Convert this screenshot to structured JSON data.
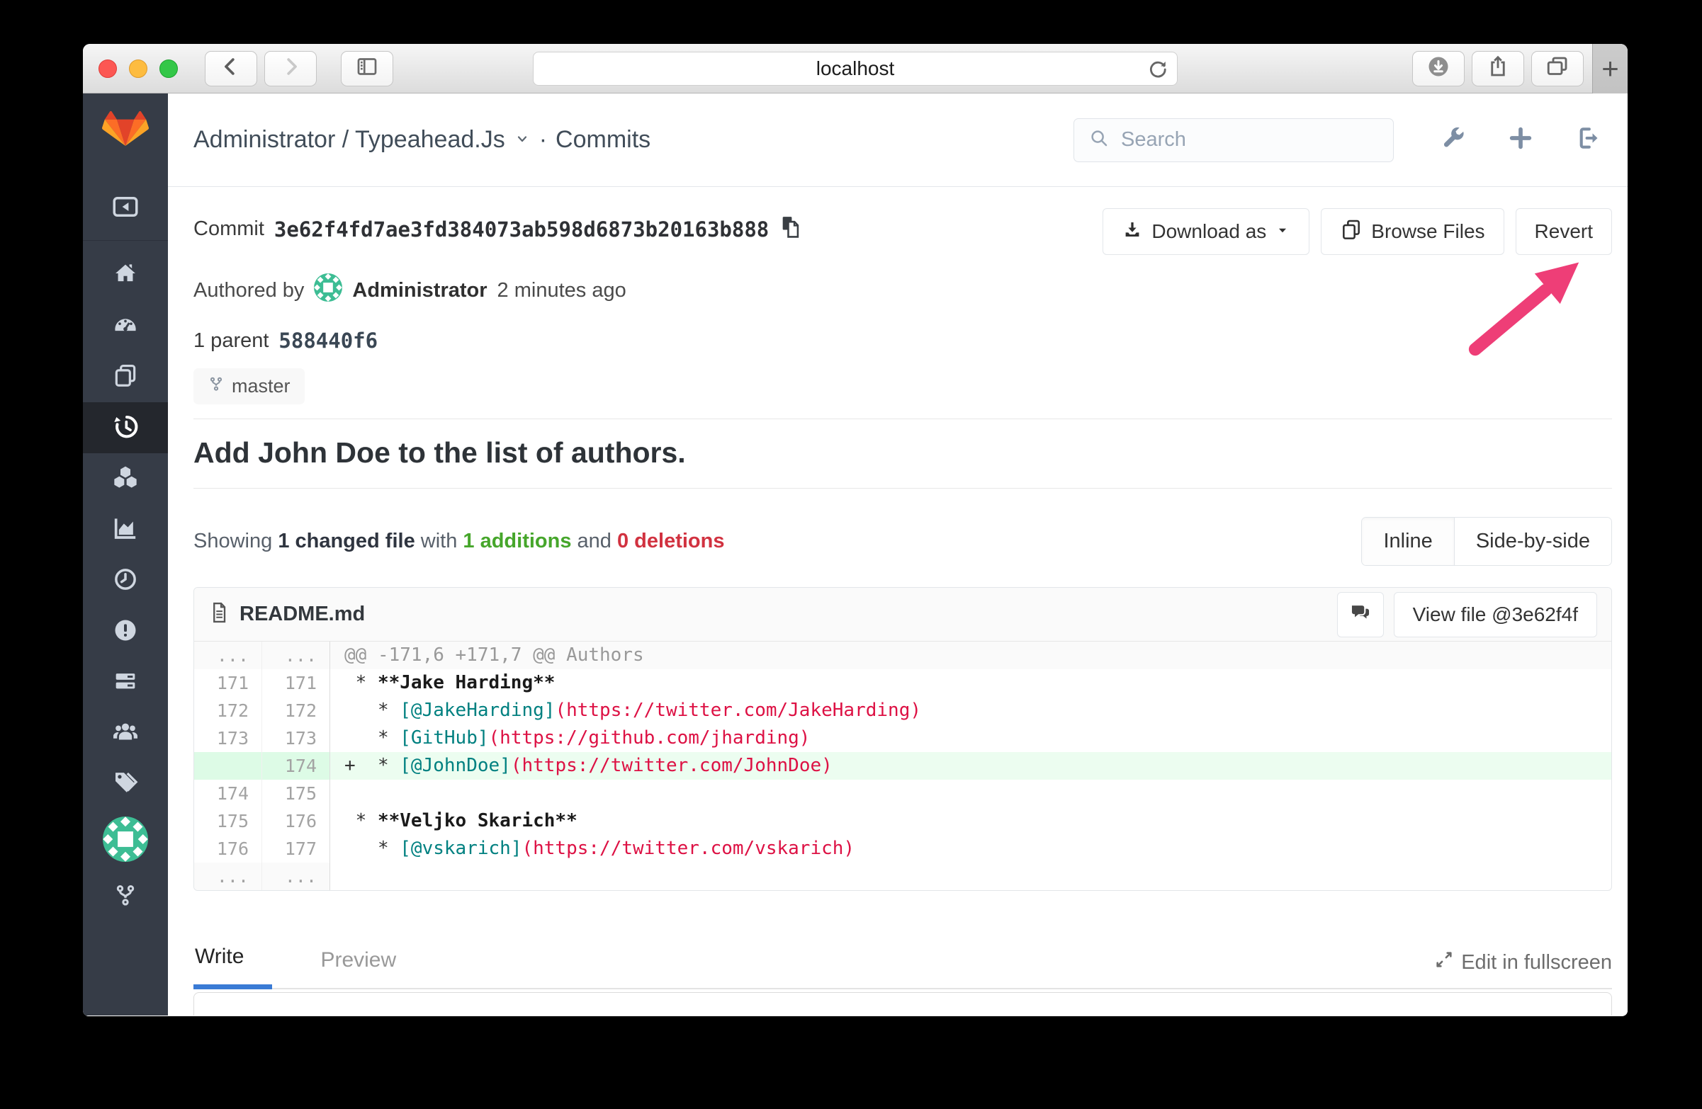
{
  "browser": {
    "url": "localhost",
    "new_tab_label": "+"
  },
  "header": {
    "breadcrumb_project": "Administrator / Typeahead.Js",
    "breadcrumb_separator": "·",
    "breadcrumb_section": "Commits",
    "search_placeholder": "Search"
  },
  "commit": {
    "label": "Commit",
    "sha": "3e62f4fd7ae3fd384073ab598d6873b20163b888",
    "authored_prefix": "Authored by",
    "author": "Administrator",
    "authored_time": "2 minutes ago",
    "parent_label": "1 parent",
    "parent_sha": "588440f6",
    "branch": "master",
    "title": "Add John Doe to the list of authors."
  },
  "actions": {
    "download_label": "Download as",
    "browse_label": "Browse Files",
    "revert_label": "Revert"
  },
  "summary": {
    "prefix": "Showing",
    "changed_file": "1 changed file",
    "with_word": "with",
    "additions": "1 additions",
    "and_word": "and",
    "deletions": "0 deletions"
  },
  "view_toggle": {
    "inline": "Inline",
    "side_by_side": "Side-by-side"
  },
  "diff": {
    "file_name": "README.md",
    "view_file_label": "View file @3e62f4f",
    "rows": [
      {
        "old": "...",
        "new": "...",
        "type": "hunk",
        "sign": "",
        "segments": [
          {
            "text": "@@ -171,6 +171,7 @@ Authors",
            "style": "gray"
          }
        ]
      },
      {
        "old": "171",
        "new": "171",
        "type": "context",
        "sign": "",
        "segments": [
          {
            "text": " * ",
            "style": "plain"
          },
          {
            "text": "**Jake Harding**",
            "style": "bold"
          }
        ]
      },
      {
        "old": "172",
        "new": "172",
        "type": "context",
        "sign": "",
        "segments": [
          {
            "text": "   * ",
            "style": "plain"
          },
          {
            "text": "[@JakeHarding]",
            "style": "teal"
          },
          {
            "text": "(https://twitter.com/JakeHarding)",
            "style": "red"
          }
        ]
      },
      {
        "old": "173",
        "new": "173",
        "type": "context",
        "sign": "",
        "segments": [
          {
            "text": "   * ",
            "style": "plain"
          },
          {
            "text": "[GitHub]",
            "style": "teal"
          },
          {
            "text": "(https://github.com/jharding)",
            "style": "red"
          }
        ]
      },
      {
        "old": "",
        "new": "174",
        "type": "added",
        "sign": "+",
        "segments": [
          {
            "text": "  * ",
            "style": "plain"
          },
          {
            "text": "[@JohnDoe]",
            "style": "teal"
          },
          {
            "text": "(https://twitter.com/JohnDoe)",
            "style": "red"
          }
        ]
      },
      {
        "old": "174",
        "new": "175",
        "type": "context",
        "sign": "",
        "segments": []
      },
      {
        "old": "175",
        "new": "176",
        "type": "context",
        "sign": "",
        "segments": [
          {
            "text": " * ",
            "style": "plain"
          },
          {
            "text": "**Veljko Skarich**",
            "style": "bold"
          }
        ]
      },
      {
        "old": "176",
        "new": "177",
        "type": "context",
        "sign": "",
        "segments": [
          {
            "text": "   * ",
            "style": "plain"
          },
          {
            "text": "[@vskarich]",
            "style": "teal"
          },
          {
            "text": "(https://twitter.com/vskarich)",
            "style": "red"
          }
        ]
      },
      {
        "old": "...",
        "new": "...",
        "type": "ellipsis",
        "sign": "",
        "segments": []
      }
    ]
  },
  "editor": {
    "write_tab": "Write",
    "preview_tab": "Preview",
    "fullscreen_label": "Edit in fullscreen"
  },
  "sidebar": {
    "selected": "history",
    "icon_names": [
      "collapse",
      "home",
      "dashboard",
      "files",
      "history",
      "builds",
      "graphs",
      "milestones",
      "issues",
      "merge-requests",
      "members",
      "labels",
      "project-avatar",
      "fork"
    ]
  },
  "icons": {
    "toolbar": [
      "close",
      "minimize",
      "zoom",
      "back",
      "forward",
      "sidebar-toggle",
      "refresh",
      "downloads",
      "share",
      "tabs-overview",
      "new-tab"
    ],
    "header": [
      "search-magnifier",
      "wrench",
      "plus",
      "sign-out"
    ],
    "content": [
      "copy-sha",
      "download-tray",
      "caret-down",
      "copy-files",
      "branch",
      "document",
      "comment-bubbles",
      "expand-arrows"
    ]
  },
  "annotation_arrow": {
    "color": "#ee3e77"
  },
  "colors": {
    "additions_green": "#46a62b",
    "deletions_red": "#d13240",
    "code_teal": "#008080",
    "code_red": "#dd1144",
    "added_line_bg": "#ecfdf0",
    "sidebar_bg": "#363c47",
    "active_tab_blue": "#3a7bd5"
  }
}
